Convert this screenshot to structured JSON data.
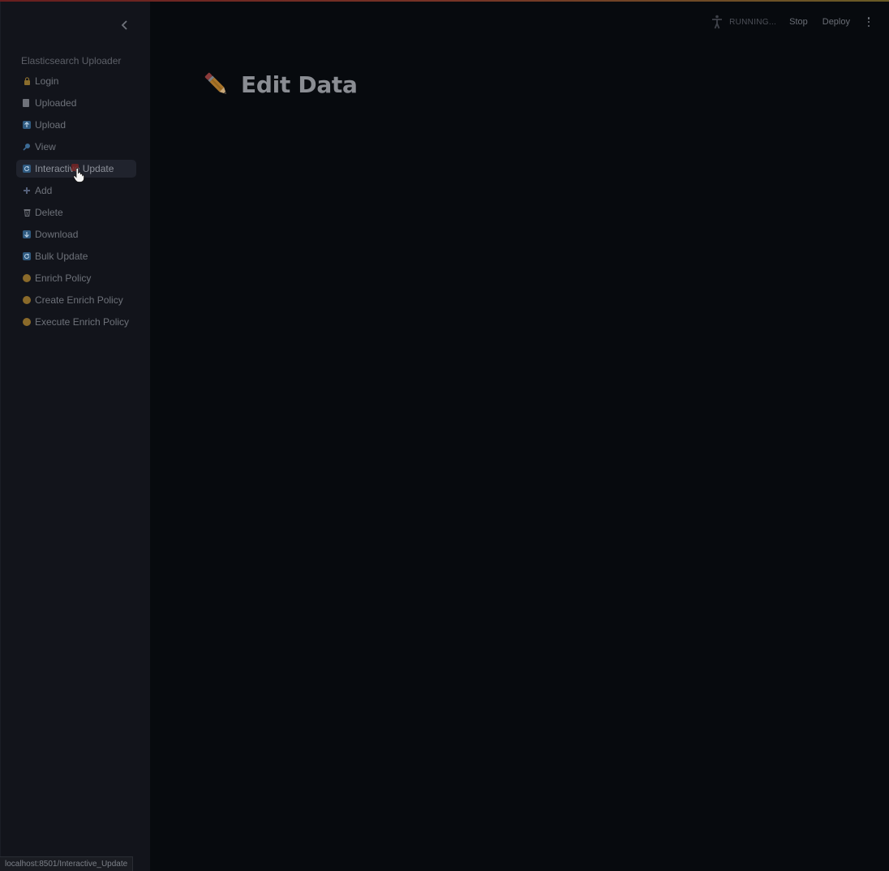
{
  "sidebar": {
    "app_title": "Elasticsearch Uploader",
    "items": [
      {
        "label": "Login",
        "icon": "lock-icon"
      },
      {
        "label": "Uploaded",
        "icon": "document-icon"
      },
      {
        "label": "Upload",
        "icon": "upload-arrow-icon"
      },
      {
        "label": "View",
        "icon": "magnifier-icon"
      },
      {
        "label": "Interactive Update",
        "icon": "refresh-icon",
        "active": true
      },
      {
        "label": "Add",
        "icon": "plus-icon"
      },
      {
        "label": "Delete",
        "icon": "wastebasket-icon"
      },
      {
        "label": "Download",
        "icon": "download-arrow-icon"
      },
      {
        "label": "Bulk Update",
        "icon": "refresh-icon"
      },
      {
        "label": "Enrich Policy",
        "icon": "circle-icon"
      },
      {
        "label": "Create Enrich Policy",
        "icon": "circle-icon"
      },
      {
        "label": "Execute Enrich Policy",
        "icon": "circle-icon"
      }
    ]
  },
  "toolbar": {
    "status": "RUNNING...",
    "stop_label": "Stop",
    "deploy_label": "Deploy"
  },
  "main": {
    "title": "Edit Data",
    "title_icon": "pencil-icon"
  },
  "statusbar": {
    "url": "localhost:8501/Interactive_Update"
  },
  "colors": {
    "background": "#070a0e",
    "sidebar": "#12141b",
    "accent_dot": "#8a6a2a"
  }
}
